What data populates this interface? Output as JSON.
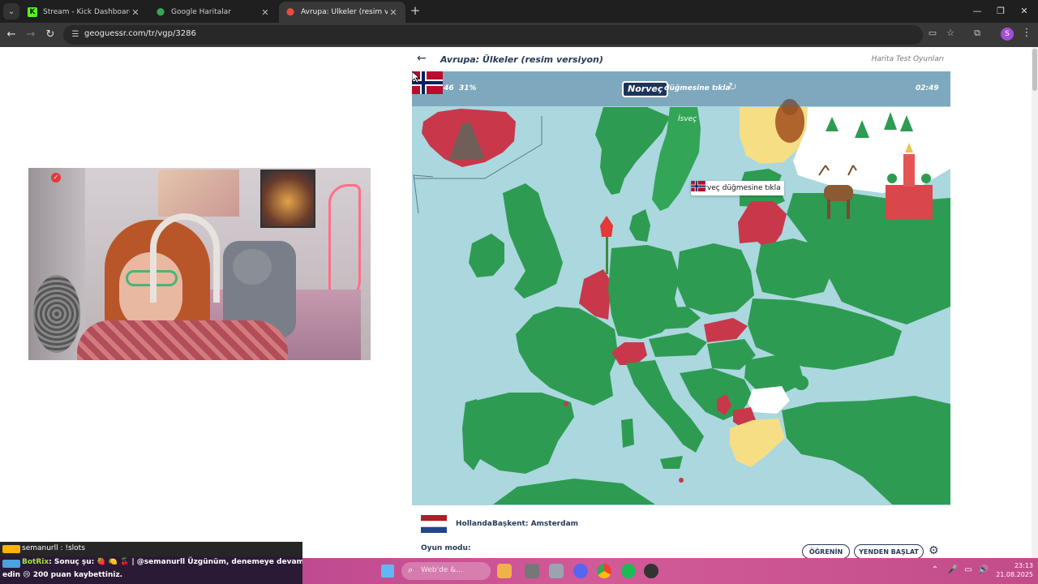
{
  "browser": {
    "tabs": [
      {
        "title": "Stream - Kick Dashboard",
        "icon": "kick-icon",
        "color": "#53fc18"
      },
      {
        "title": "Google Haritalar",
        "icon": "maps-pin-icon",
        "color": "#34a853"
      },
      {
        "title": "Avrupa: Ülkeler (resim versiyon)",
        "icon": "pin-icon",
        "color": "#e74c3c"
      }
    ],
    "url": "geoguessr.com/tr/vgp/3286"
  },
  "game": {
    "title": "Avrupa: Ülkeler (resim versiyon)",
    "header_link": "Harita Test Oyunları",
    "score": "16 / 46",
    "percent": "31%",
    "target": "Norveç",
    "target_suffix": "düğmesine tıkla",
    "timer": "02:49",
    "map_label": "İsveç",
    "tooltip": "Norveç düğmesine tıkla",
    "last_country": "Hollanda",
    "capital": "Başkent: Amsterdam",
    "mode_label": "Oyun modu:",
    "learn_button": "ÖĞRENİN",
    "restart_button": "YENDEN BAŞLAT",
    "colors": {
      "land": "#2e9b52",
      "wrong": "#c8384a",
      "unplayed": "#f6de85",
      "sea": "#abd7df",
      "navy": "#1d3557"
    }
  },
  "chat": {
    "top_user": "semanurll : !slots",
    "bot_name": "BotRix",
    "line1": ": Sonuç şu: 🍓 🍋 🍒 | @semanurll Üzgünüm, denemeye devam",
    "line2": "edin 😢 200 puan kaybettiniz."
  },
  "taskbar": {
    "search_placeholder": "Web'de &...",
    "time": "23:13",
    "date": "21.08.2025"
  }
}
